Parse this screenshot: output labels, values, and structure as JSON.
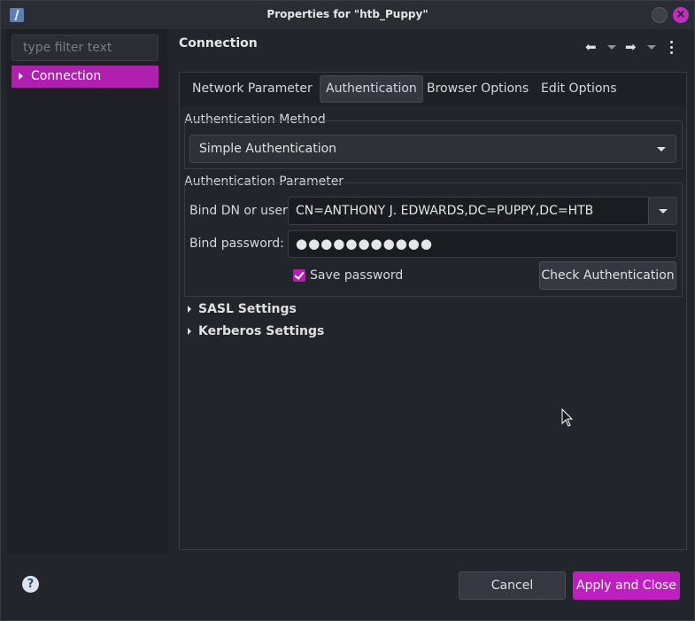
{
  "window": {
    "title": "Properties for \"htb_Puppy\""
  },
  "sidebar": {
    "filter_placeholder": "type filter text",
    "items": [
      {
        "label": "Connection",
        "selected": true
      }
    ]
  },
  "page": {
    "title": "Connection",
    "tabs": [
      {
        "label": "Network Parameter",
        "active": false
      },
      {
        "label": "Authentication",
        "active": true
      },
      {
        "label": "Browser Options",
        "active": false
      },
      {
        "label": "Edit Options",
        "active": false
      }
    ],
    "auth_method": {
      "group_label": "Authentication Method",
      "selected": "Simple Authentication"
    },
    "auth_param": {
      "group_label": "Authentication Parameter",
      "bind_dn_label": "Bind DN or user:",
      "bind_dn_value": "CN=ANTHONY J. EDWARDS,DC=PUPPY,DC=HTB",
      "bind_password_label": "Bind password:",
      "bind_password_value": "●●●●●●●●●●●",
      "save_password_label": "Save password",
      "save_password_checked": true,
      "check_auth_label": "Check Authentication"
    },
    "sections": [
      {
        "label": "SASL Settings"
      },
      {
        "label": "Kerberos Settings"
      }
    ]
  },
  "footer": {
    "help_glyph": "?",
    "cancel_label": "Cancel",
    "apply_label": "Apply and Close"
  },
  "colors": {
    "accent": "#c01fc0",
    "background": "#22252b",
    "panel": "#1e2026"
  },
  "icons": {
    "back": "arrow-left-icon",
    "forward": "arrow-right-icon",
    "menu": "vertical-ellipsis-icon",
    "help": "help-icon"
  }
}
